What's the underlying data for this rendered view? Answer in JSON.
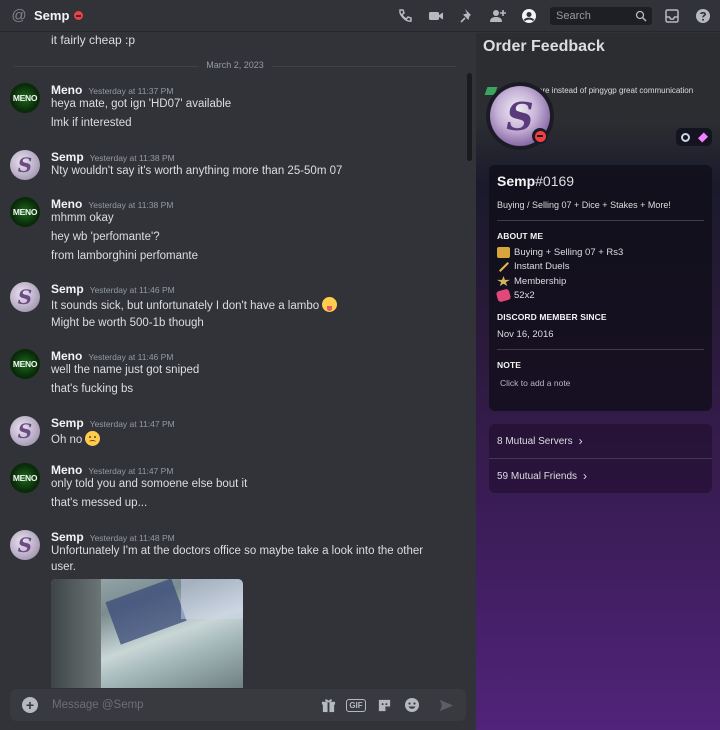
{
  "header": {
    "name": "Semp",
    "search_placeholder": "Search"
  },
  "chat": {
    "top_line": "it fairly cheap :p",
    "date_divider": "March 2, 2023",
    "messages": [
      {
        "author": "Meno",
        "time": "Yesterday at 11:37 PM",
        "lines": [
          "heya mate, got ign 'HD07' available",
          "lmk if interested"
        ]
      },
      {
        "author": "Semp",
        "time": "Yesterday at 11:38 PM",
        "lines": [
          "Nty wouldn't say it's worth anything more than 25-50m 07"
        ]
      },
      {
        "author": "Meno",
        "time": "Yesterday at 11:38 PM",
        "lines": [
          "mhmm okay",
          "hey wb 'perfomante'?",
          "from lamborghini perfomante"
        ]
      },
      {
        "author": "Semp",
        "time": "Yesterday at 11:46 PM",
        "lines": [
          "It sounds sick, but unfortunately I don't have a lambo",
          "Might be worth 500-1b though"
        ]
      },
      {
        "author": "Meno",
        "time": "Yesterday at 11:46 PM",
        "lines": [
          "well the name just got sniped",
          "that's fucking bs"
        ]
      },
      {
        "author": "Semp",
        "time": "Yesterday at 11:47 PM",
        "lines": [
          "Oh no"
        ]
      },
      {
        "author": "Meno",
        "time": "Yesterday at 11:47 PM",
        "lines": [
          "only told you and somoene else bout it",
          "that's messed up..."
        ]
      },
      {
        "author": "Semp",
        "time": "Yesterday at 11:48 PM",
        "lines": [
          "Unfortunately I'm at the doctors office so maybe take a look into the other user."
        ]
      }
    ],
    "avatar_text_meno": "MENO",
    "avatar_text_semp": "S"
  },
  "composer": {
    "placeholder": "Message @Semp",
    "gif_label": "GIF"
  },
  "panel": {
    "title": "Order Feedback",
    "banner_text": "ere instead of pingygp great communication",
    "avatar_letter": "S",
    "username": "Semp",
    "discriminator": "#0169",
    "custom_status": "Buying / Selling 07 + Dice + Stakes + More!",
    "about_me_heading": "ABOUT ME",
    "about_lines": [
      "Buying + Selling 07 + Rs3",
      "Instant Duels",
      "Membership",
      "52x2"
    ],
    "member_since_heading": "DISCORD MEMBER SINCE",
    "member_since": "Nov 16, 2016",
    "note_heading": "NOTE",
    "note_placeholder": "Click to add a note",
    "mutual_servers": "8 Mutual Servers",
    "mutual_friends": "59 Mutual Friends"
  },
  "colors": {
    "background": "#313338",
    "dnd": "#f23f43",
    "panel_gradient_end": "#51237a"
  }
}
